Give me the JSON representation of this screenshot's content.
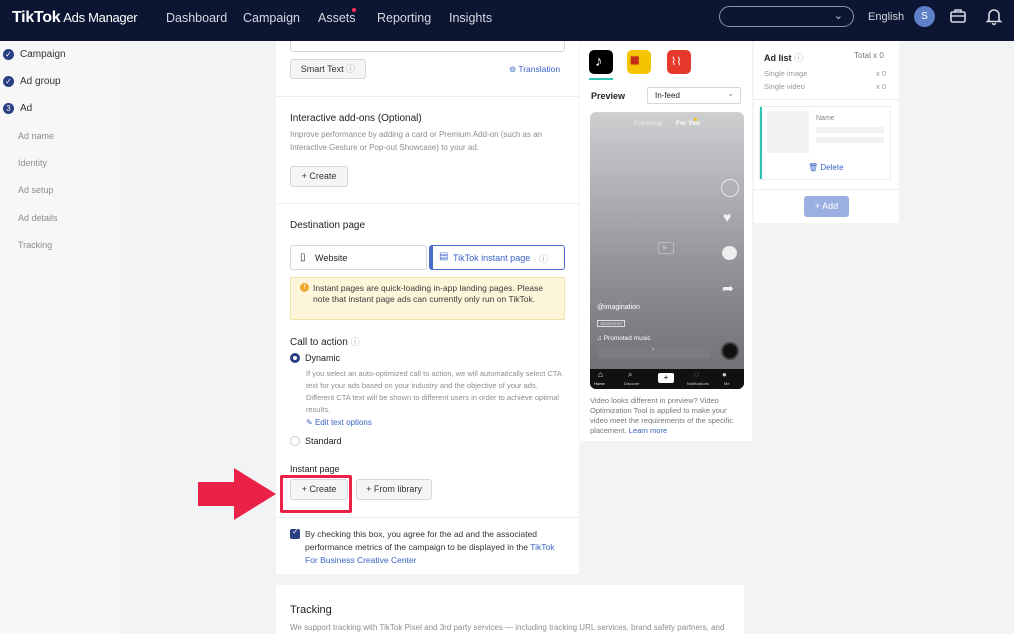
{
  "topbar": {
    "logo": "TikTok",
    "logo_sub": "Ads Manager",
    "nav": [
      "Dashboard",
      "Campaign",
      "Assets",
      "Reporting",
      "Insights"
    ],
    "language": "English",
    "avatar_initial": "S"
  },
  "sidebar": {
    "steps": [
      "Campaign",
      "Ad group",
      "Ad"
    ],
    "active_step_number": "3",
    "substeps": [
      "Ad name",
      "Identity",
      "Ad setup",
      "Ad details",
      "Tracking"
    ]
  },
  "form": {
    "smart_text_label": "Smart Text",
    "translation_label": "Translation",
    "interactive": {
      "title": "Interactive add-ons (Optional)",
      "desc": "Improve performance by adding a card or Premium Add-on (such as an Interactive Gesture or Pop-out Showcase) to your ad.",
      "create_label": "+ Create"
    },
    "destination": {
      "title": "Destination page",
      "website_label": "Website",
      "instant_label": "TikTok instant page",
      "info": "Instant pages are quick-loading in-app landing pages. Please note that instant page ads can currently only run on TikTok."
    },
    "cta": {
      "title": "Call to action",
      "dynamic_label": "Dynamic",
      "dynamic_desc": "If you select an auto-optimized call to action, we will automatically select CTA text for your ads based on your industry and the objective of your ads. Different CTA text will be shown to different users in order to achieve optimal results.",
      "edit_label": "Edit text options",
      "standard_label": "Standard"
    },
    "instant_page": {
      "title": "Instant page",
      "create_label": "+ Create",
      "library_label": "+ From library"
    },
    "consent_text": "By checking this box, you agree for the ad and the associated performance metrics of the campaign to be displayed in the",
    "consent_link": "TikTok For Business Creative Center",
    "tracking": {
      "title": "Tracking",
      "desc": "We support tracking with TikTok Pixel and 3rd party services — including tracking URL services, brand safety partners, and"
    }
  },
  "preview": {
    "label": "Preview",
    "placement_select": "In-feed",
    "feed_tabs": [
      "Following",
      "For You"
    ],
    "username": "@imagination",
    "sponsored": "Sponsored",
    "music": "Promoted music",
    "nav_labels": [
      "Home",
      "Discover",
      "",
      "Notifications",
      "Me"
    ],
    "note": "Video looks different in preview? Video Optimization Tool is applied to make your video meet the requirements of the specific placement.",
    "learn_more": "Learn more"
  },
  "adlist": {
    "title": "Ad list",
    "total": "Total x 0",
    "rows": [
      {
        "label": "Single image",
        "count": "x 0"
      },
      {
        "label": "Single video",
        "count": "x 0"
      }
    ],
    "item_name": "Name",
    "delete_label": "Delete",
    "add_label": "+ Add"
  },
  "colors": {
    "nav_bg": "#0c1532",
    "accent": "#2a3e82",
    "highlight": "#ea2248"
  }
}
